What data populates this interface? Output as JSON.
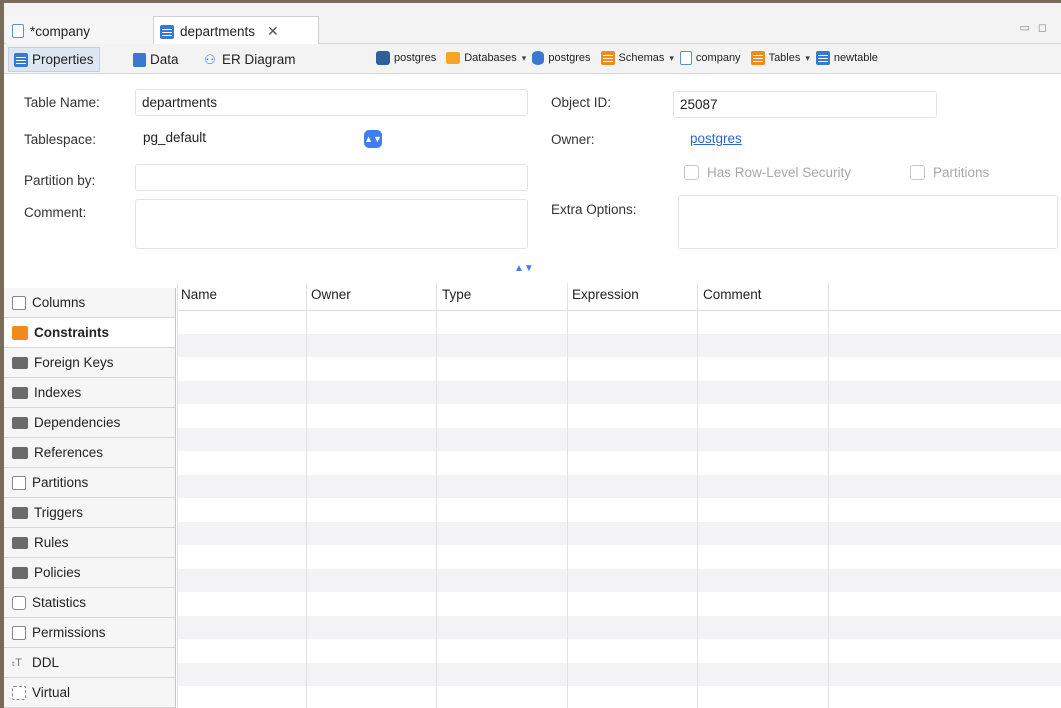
{
  "tabs": [
    {
      "label": "*company",
      "icon": "doc-icon"
    },
    {
      "label": "departments",
      "icon": "table-icon",
      "close": "✕"
    }
  ],
  "subtabs": [
    {
      "label": "Properties",
      "icon": "table-icon",
      "active": true
    },
    {
      "label": "Data",
      "icon": "data-icon"
    },
    {
      "label": "ER Diagram",
      "icon": "er-diagram-icon"
    }
  ],
  "breadcrumbs": [
    {
      "label": "postgres",
      "icon": "postgres-icon"
    },
    {
      "label": "Databases",
      "icon": "folder-icon",
      "dropdown": "▾"
    },
    {
      "label": "postgres",
      "icon": "database-icon"
    },
    {
      "label": "Schemas",
      "icon": "schemas-icon",
      "dropdown": "▾"
    },
    {
      "label": "company",
      "icon": "doc-icon"
    },
    {
      "label": "Tables",
      "icon": "tables-icon",
      "dropdown": "▾"
    },
    {
      "label": "newtable",
      "icon": "table-icon"
    }
  ],
  "form": {
    "table_name_label": "Table Name:",
    "table_name_value": "departments",
    "tablespace_label": "Tablespace:",
    "tablespace_value": "pg_default",
    "partition_by_label": "Partition by:",
    "partition_by_value": "",
    "comment_label": "Comment:",
    "comment_value": "",
    "object_id_label": "Object ID:",
    "object_id_value": "25087",
    "owner_label": "Owner:",
    "owner_value": "postgres",
    "has_rls_label": "Has Row-Level Security",
    "partitions_label": "Partitions",
    "extra_options_label": "Extra Options:",
    "extra_options_value": ""
  },
  "sidebar": {
    "items": [
      {
        "label": "Columns",
        "icon": "columns-icon",
        "active": false
      },
      {
        "label": "Constraints",
        "icon": "constraints-icon",
        "active": true
      },
      {
        "label": "Foreign Keys",
        "icon": "folder-icon",
        "active": false
      },
      {
        "label": "Indexes",
        "icon": "folder-icon",
        "active": false
      },
      {
        "label": "Dependencies",
        "icon": "folder-icon",
        "active": false
      },
      {
        "label": "References",
        "icon": "folder-icon",
        "active": false
      },
      {
        "label": "Partitions",
        "icon": "partitions-icon",
        "active": false
      },
      {
        "label": "Triggers",
        "icon": "folder-icon",
        "active": false
      },
      {
        "label": "Rules",
        "icon": "folder-icon",
        "active": false
      },
      {
        "label": "Policies",
        "icon": "folder-icon",
        "active": false
      },
      {
        "label": "Statistics",
        "icon": "info-icon",
        "active": false
      },
      {
        "label": "Permissions",
        "icon": "permissions-icon",
        "active": false
      },
      {
        "label": "DDL",
        "icon": "ddl-icon",
        "active": false
      },
      {
        "label": "Virtual",
        "icon": "virtual-icon",
        "active": false
      }
    ]
  },
  "grid": {
    "columns": [
      "Name",
      "Owner",
      "Type",
      "Expression",
      "Comment"
    ]
  },
  "colors": {
    "accent": "#3d7ef0",
    "link": "#2867d8",
    "frame": "#7a6a5a"
  }
}
